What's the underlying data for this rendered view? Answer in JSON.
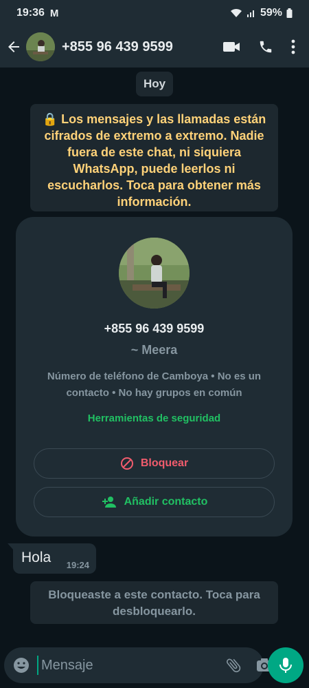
{
  "status_bar": {
    "time": "19:36",
    "gmail_badge": "M",
    "battery": "59%"
  },
  "header": {
    "title": "+855 96 439 9599",
    "icons": [
      "back-arrow-icon",
      "video-call-icon",
      "phone-icon",
      "more-vert-icon"
    ]
  },
  "chat": {
    "date_chip": "Hoy",
    "encryption_notice": "🔒 Los mensajes y las llamadas están cifrados de extremo a extremo. Nadie fuera de este chat, ni siquiera WhatsApp, puede leerlos ni escucharlos. Toca para obtener más información.",
    "contact_card": {
      "phone": "+855 96 439 9599",
      "name": "~ Meera",
      "info": "Número de teléfono de Camboya • No es un contacto • No hay grupos en común",
      "security_link": "Herramientas de seguridad",
      "block_label": "Bloquear",
      "add_contact_label": "Añadir contacto"
    },
    "message": {
      "text": "Hola",
      "time": "19:24"
    },
    "blocked_notice": "Bloqueaste a este contacto. Toca para desbloquearlo."
  },
  "composer": {
    "placeholder": "Mensaje"
  },
  "colors": {
    "background": "#0b141a",
    "bar": "#1f2c34",
    "accent_green": "#00a884",
    "link_green": "#21c063",
    "danger": "#f15c6d",
    "notice_yellow": "#ffd279"
  }
}
